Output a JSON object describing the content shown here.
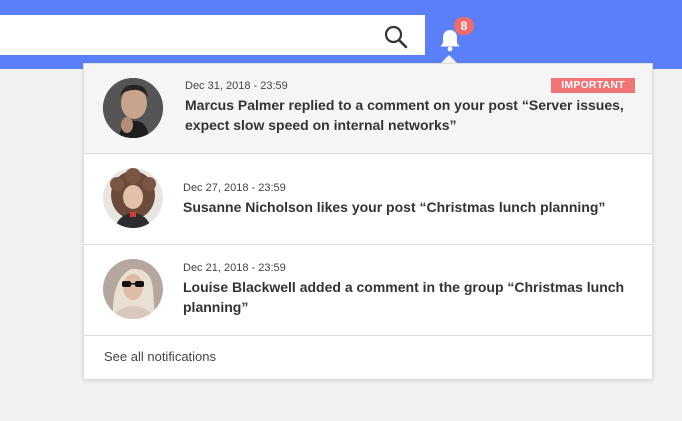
{
  "search": {
    "value": "",
    "placeholder": ""
  },
  "notifications": {
    "badge_count": "8",
    "items": [
      {
        "date": "Dec 31, 2018 - 23:59",
        "tag": "IMPORTANT",
        "text": "Marcus Palmer replied to a comment on your post “Server issues, expect slow speed on internal networks”"
      },
      {
        "date": "Dec 27, 2018 - 23:59",
        "text": "Susanne Nicholson likes your post “Christmas lunch planning”"
      },
      {
        "date": "Dec 21, 2018 - 23:59",
        "text": "Louise Blackwell added a comment in the group “Christmas lunch planning”"
      }
    ],
    "see_all_label": "See all notifications"
  },
  "colors": {
    "header": "#5b7ff8",
    "badge": "#f06b6b",
    "important_tag": "#f07474",
    "unread_bg": "#f5f5f5"
  },
  "icons": {
    "search": "search-icon",
    "notifications": "bell-icon"
  }
}
